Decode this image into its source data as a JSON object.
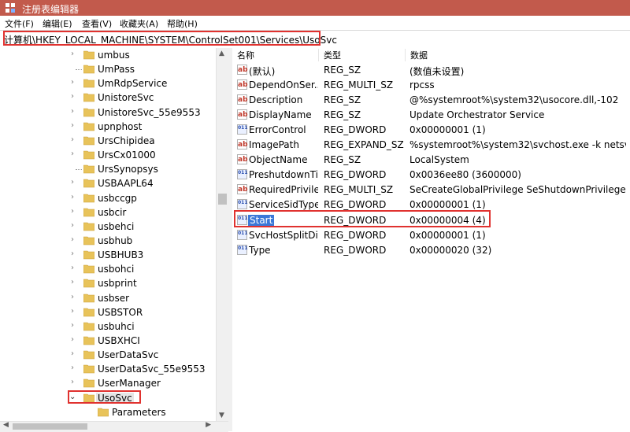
{
  "window": {
    "title": "注册表编辑器"
  },
  "menu": [
    {
      "label": "文件(F)"
    },
    {
      "label": "编辑(E)"
    },
    {
      "label": "查看(V)"
    },
    {
      "label": "收藏夹(A)"
    },
    {
      "label": "帮助(H)"
    }
  ],
  "address": {
    "path": "计算机\\HKEY_LOCAL_MACHINE\\SYSTEM\\ControlSet001\\Services\\UsoSvc"
  },
  "tree": {
    "items": [
      {
        "label": "umbus",
        "expander": "›"
      },
      {
        "label": "UmPass",
        "expander": ""
      },
      {
        "label": "UmRdpService",
        "expander": "›"
      },
      {
        "label": "UnistoreSvc",
        "expander": "›"
      },
      {
        "label": "UnistoreSvc_55e9553",
        "expander": "›"
      },
      {
        "label": "upnphost",
        "expander": "›"
      },
      {
        "label": "UrsChipidea",
        "expander": "›"
      },
      {
        "label": "UrsCx01000",
        "expander": "›"
      },
      {
        "label": "UrsSynopsys",
        "expander": ""
      },
      {
        "label": "USBAAPL64",
        "expander": "›"
      },
      {
        "label": "usbccgp",
        "expander": "›"
      },
      {
        "label": "usbcir",
        "expander": "›"
      },
      {
        "label": "usbehci",
        "expander": "›"
      },
      {
        "label": "usbhub",
        "expander": "›"
      },
      {
        "label": "USBHUB3",
        "expander": "›"
      },
      {
        "label": "usbohci",
        "expander": "›"
      },
      {
        "label": "usbprint",
        "expander": "›"
      },
      {
        "label": "usbser",
        "expander": "›"
      },
      {
        "label": "USBSTOR",
        "expander": "›"
      },
      {
        "label": "usbuhci",
        "expander": "›"
      },
      {
        "label": "USBXHCI",
        "expander": "›"
      },
      {
        "label": "UserDataSvc",
        "expander": "›"
      },
      {
        "label": "UserDataSvc_55e9553",
        "expander": "›"
      },
      {
        "label": "UserManager",
        "expander": "›"
      },
      {
        "label": "UsoSvc",
        "expander": "⌄"
      }
    ],
    "child": {
      "label": "Parameters"
    }
  },
  "list": {
    "headers": {
      "name": "名称",
      "type": "类型",
      "data": "数据"
    },
    "rows": [
      {
        "icon": "ab",
        "kind": "sz",
        "name": "(默认)",
        "type": "REG_SZ",
        "data": "(数值未设置)"
      },
      {
        "icon": "ab",
        "kind": "sz",
        "name": "DependOnSer...",
        "type": "REG_MULTI_SZ",
        "data": "rpcss"
      },
      {
        "icon": "ab",
        "kind": "sz",
        "name": "Description",
        "type": "REG_SZ",
        "data": "@%systemroot%\\system32\\usocore.dll,-102"
      },
      {
        "icon": "ab",
        "kind": "sz",
        "name": "DisplayName",
        "type": "REG_SZ",
        "data": "Update Orchestrator Service"
      },
      {
        "icon": "011",
        "kind": "dw",
        "name": "ErrorControl",
        "type": "REG_DWORD",
        "data": "0x00000001 (1)"
      },
      {
        "icon": "ab",
        "kind": "sz",
        "name": "ImagePath",
        "type": "REG_EXPAND_SZ",
        "data": "%systemroot%\\system32\\svchost.exe -k netsv..."
      },
      {
        "icon": "ab",
        "kind": "sz",
        "name": "ObjectName",
        "type": "REG_SZ",
        "data": "LocalSystem"
      },
      {
        "icon": "011",
        "kind": "dw",
        "name": "PreshutdownTi...",
        "type": "REG_DWORD",
        "data": "0x0036ee80 (3600000)"
      },
      {
        "icon": "ab",
        "kind": "sz",
        "name": "RequiredPrivile...",
        "type": "REG_MULTI_SZ",
        "data": "SeCreateGlobalPrivilege SeShutdownPrivilege"
      },
      {
        "icon": "011",
        "kind": "dw",
        "name": "ServiceSidType",
        "type": "REG_DWORD",
        "data": "0x00000001 (1)"
      },
      {
        "icon": "011",
        "kind": "dw",
        "name": "Start",
        "type": "REG_DWORD",
        "data": "0x00000004 (4)"
      },
      {
        "icon": "011",
        "kind": "dw",
        "name": "SvcHostSplitDi...",
        "type": "REG_DWORD",
        "data": "0x00000001 (1)"
      },
      {
        "icon": "011",
        "kind": "dw",
        "name": "Type",
        "type": "REG_DWORD",
        "data": "0x00000020 (32)"
      }
    ]
  },
  "colors": {
    "titlebar": "#c25a4c",
    "highlight": "#e0322f",
    "selection": "#3b78d8",
    "folder": "#e8c35a"
  }
}
